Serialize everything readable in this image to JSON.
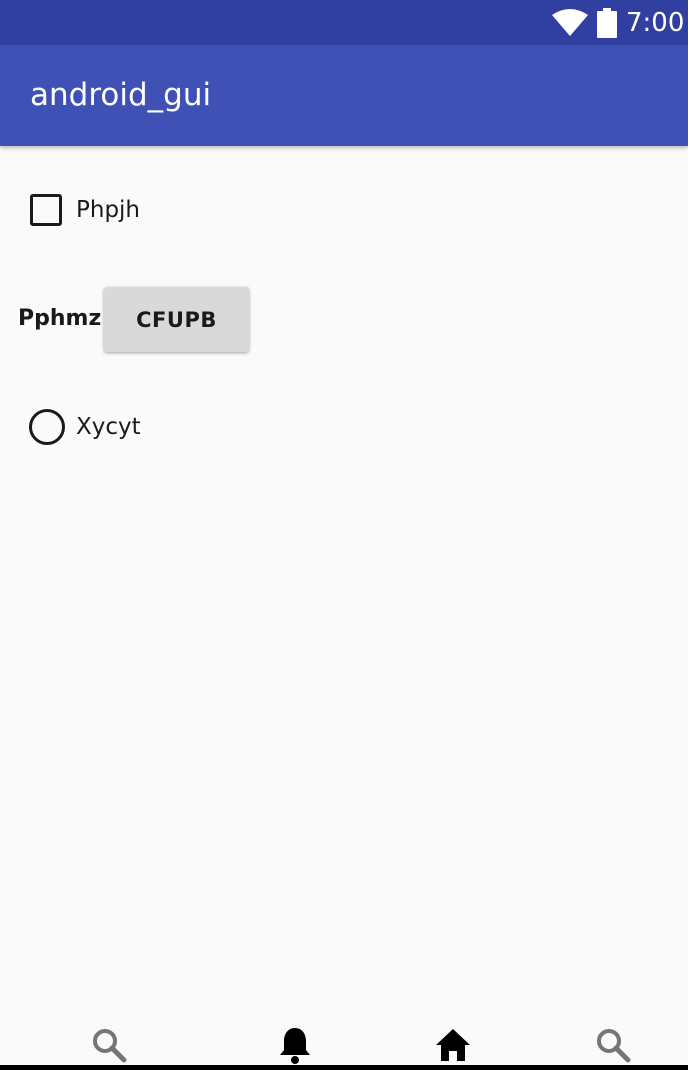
{
  "status_bar": {
    "time": "7:00",
    "icons": [
      "wifi-icon",
      "battery-icon"
    ],
    "background": "#3140a0"
  },
  "app_bar": {
    "title": "android_gui",
    "background": "#3f51b5"
  },
  "content": {
    "checkbox": {
      "label": "Phpjh",
      "checked": false
    },
    "label_text": "Pphmz",
    "button_label": "CFUPB",
    "radio": {
      "label": "Xycyt",
      "selected": false
    }
  },
  "bottom_nav": {
    "items": [
      {
        "icon": "search-icon"
      },
      {
        "icon": "bell-icon"
      },
      {
        "icon": "home-icon"
      },
      {
        "icon": "search-icon"
      }
    ]
  }
}
